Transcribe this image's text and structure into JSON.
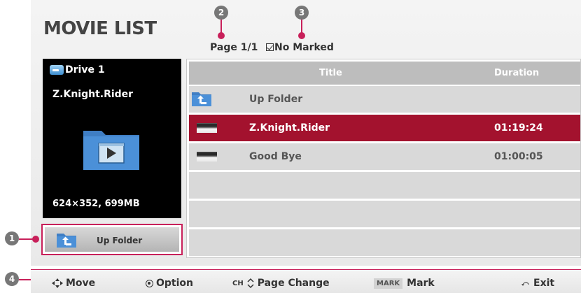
{
  "header": {
    "title": "MOVIE LIST",
    "page": "Page 1/1",
    "marked": "No Marked"
  },
  "preview": {
    "drive": "Drive 1",
    "file_name": "Z.Knight.Rider",
    "info": "624×352,  699MB"
  },
  "up_folder_button": {
    "label": "Up Folder"
  },
  "list": {
    "columns": [
      "Title",
      "Duration"
    ],
    "rows": [
      {
        "title": "Up Folder",
        "duration": "",
        "type": "folder",
        "selected": false
      },
      {
        "title": "Z.Knight.Rider",
        "duration": "01:19:24",
        "type": "movie",
        "selected": true
      },
      {
        "title": "Good Bye",
        "duration": "01:00:05",
        "type": "movie",
        "selected": false
      }
    ]
  },
  "bottom_bar": {
    "move": "Move",
    "option": "Option",
    "ch": "CH",
    "page_change": "Page Change",
    "mark_badge": "MARK",
    "mark": "Mark",
    "exit": "Exit"
  },
  "callouts": [
    "1",
    "2",
    "3",
    "4"
  ],
  "colors": {
    "accent": "#c8205a",
    "selected_row": "#a3122e"
  }
}
